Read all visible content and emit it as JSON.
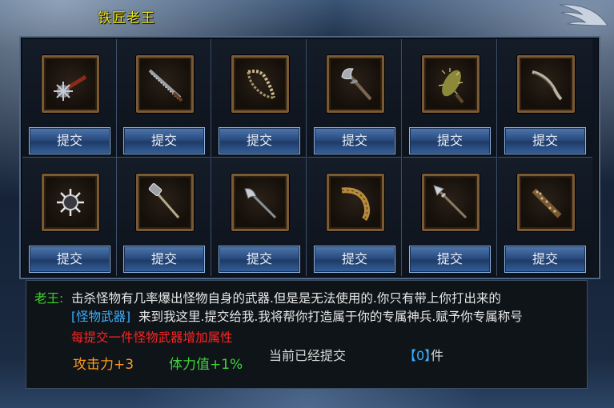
{
  "window": {
    "title": "铁匠老王"
  },
  "slots": [
    {
      "item": "spiked-mace-icon",
      "button": "提交"
    },
    {
      "item": "serrated-blade-icon",
      "button": "提交"
    },
    {
      "item": "bone-chain-icon",
      "button": "提交"
    },
    {
      "item": "battle-axe-icon",
      "button": "提交"
    },
    {
      "item": "spiked-club-icon",
      "button": "提交"
    },
    {
      "item": "curved-blade-icon",
      "button": "提交"
    },
    {
      "item": "morning-star-icon",
      "button": "提交"
    },
    {
      "item": "war-hammer-icon",
      "button": "提交"
    },
    {
      "item": "glaive-icon",
      "button": "提交"
    },
    {
      "item": "curved-horn-icon",
      "button": "提交"
    },
    {
      "item": "spear-icon",
      "button": "提交"
    },
    {
      "item": "studded-club-icon",
      "button": "提交"
    }
  ],
  "info": {
    "npc_name": "老王:",
    "line1": "击杀怪物有几率爆出怪物自身的武器.但是是无法使用的.你只有带上你打出来的",
    "monster_weapon": "[怪物武器]",
    "line2": "来到我这里.提交给我.我将帮你打造属于你的专属神兵.赋予你专属称号",
    "bonus_title": "每提交一件怪物武器增加属性",
    "attack_bonus": "攻击力+3",
    "hp_bonus": "体力值+1%",
    "count_label": "当前已经提交",
    "count_value": "【0】",
    "count_unit": "件"
  },
  "colors": {
    "title": "#f0e61e",
    "npc": "#39d427",
    "highlight": "#3ab0ff",
    "bonus_title": "#ff2424",
    "attack": "#ff9a1e",
    "hp": "#3ed43a"
  }
}
